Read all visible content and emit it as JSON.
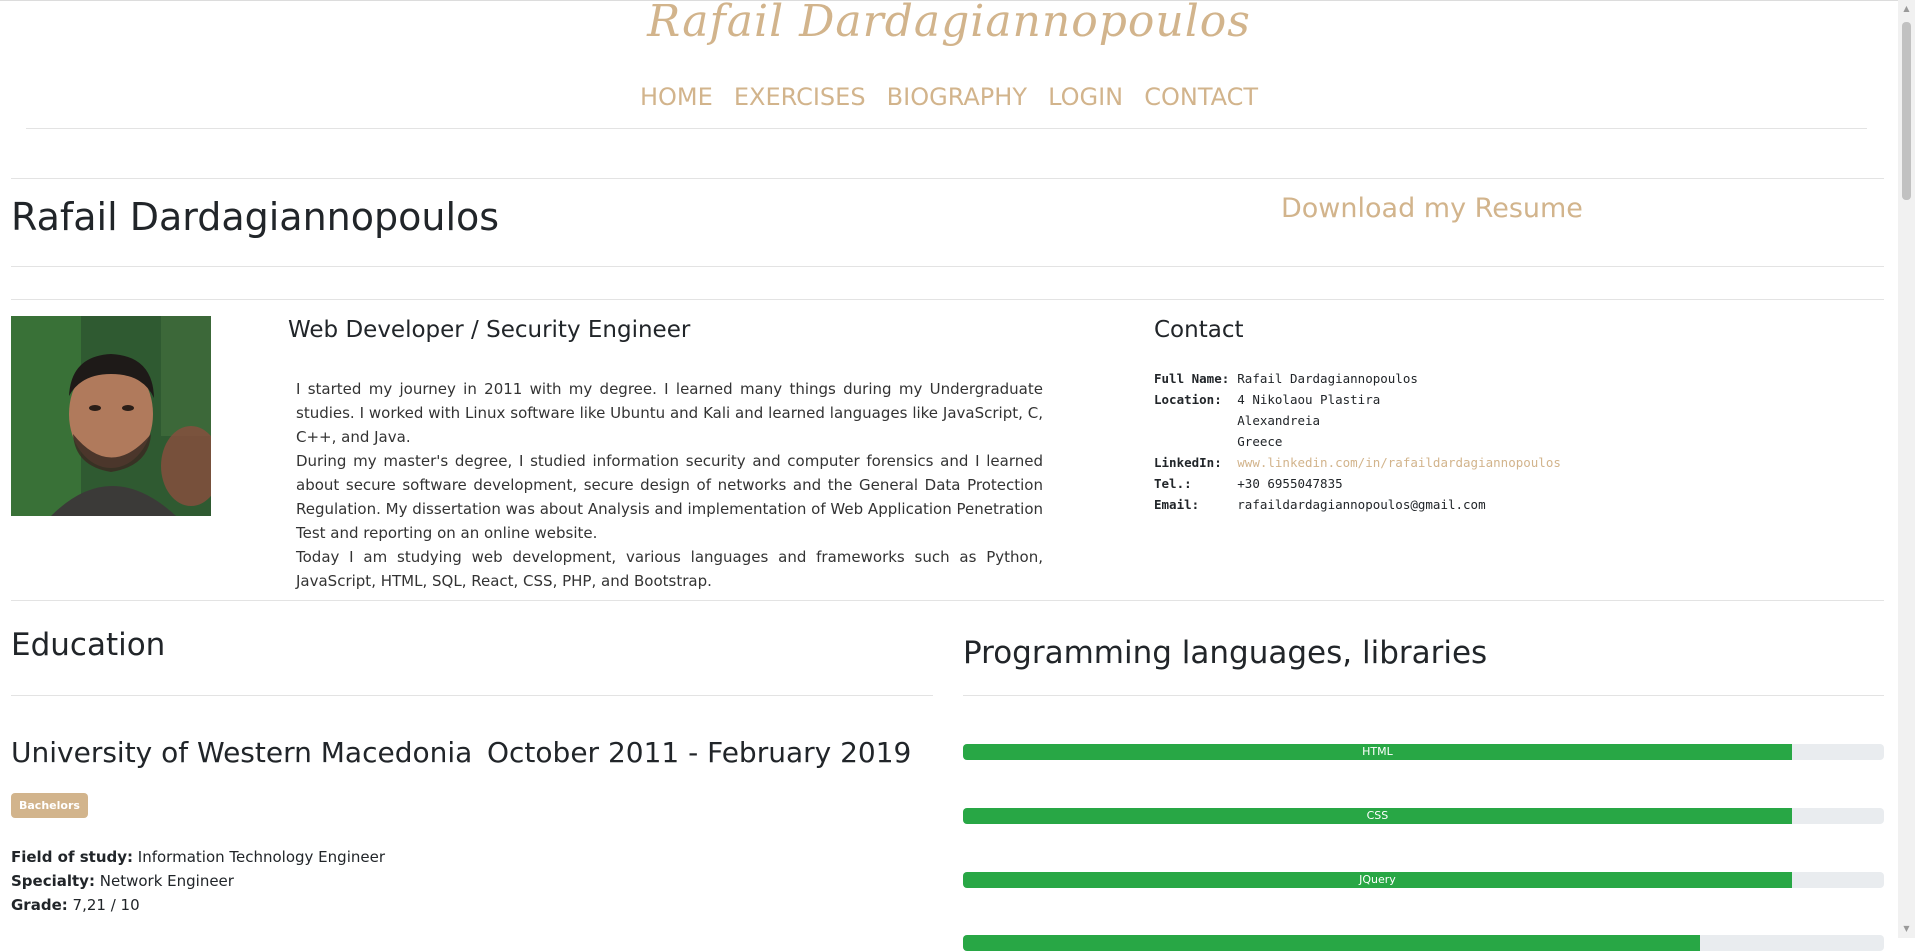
{
  "site": {
    "title": "Rafail Dardagiannopoulos"
  },
  "nav": [
    "HOME",
    "EXERCISES",
    "BIOGRAPHY",
    "LOGIN",
    "CONTACT"
  ],
  "header": {
    "name": "Rafail Dardagiannopoulos",
    "resume_link": "Download my Resume"
  },
  "profile": {
    "job_title": "Web Developer / Security Engineer",
    "bio": [
      "I started my journey in 2011 with my degree. I learned many things during my Undergraduate studies. I worked with Linux software like Ubuntu and Kali and learned languages like JavaScript, C, C++, and Java.",
      "During my master's degree, I studied information security and computer forensics and I learned about secure software development, secure design of networks and the General Data Protection Regulation. My dissertation was about Analysis and implementation of Web Application Penetration Test and reporting on an online website.",
      "Today I am studying web development, various languages and frameworks such as Python, JavaScript, HTML, SQL, React, CSS, PHP, and Bootstrap."
    ]
  },
  "contact": {
    "heading": "Contact",
    "full_name_label": "Full Name:",
    "full_name": "Rafail Dardagiannopoulos",
    "location_label": "Location:",
    "location": [
      "4 Nikolaou Plastira",
      "Alexandreia",
      "Greece"
    ],
    "linkedin_label": "LinkedIn:",
    "linkedin": "www.linkedin.com/in/rafaildardagiannopoulos",
    "tel_label": "Tel.:",
    "tel": "+30 6955047835",
    "email_label": "Email:",
    "email": "rafaildardagiannopoulos@gmail.com"
  },
  "education": {
    "heading": "Education",
    "entries": [
      {
        "school": "University of Western Macedonia",
        "period": "October 2011 - February 2019",
        "badge": "Bachelors",
        "field_label": "Field of study:",
        "field": "Information Technology Engineer",
        "specialty_label": "Specialty:",
        "specialty": "Network Engineer",
        "grade_label": "Grade:",
        "grade": "7,21 / 10"
      }
    ]
  },
  "skills": {
    "heading": "Programming languages, libraries",
    "items": [
      {
        "name": "HTML",
        "level": 0.9
      },
      {
        "name": "CSS",
        "level": 0.9
      },
      {
        "name": "JQuery",
        "level": 0.9
      },
      {
        "name": "",
        "level": 0.8
      }
    ]
  },
  "colors": {
    "accent": "#d2b48c",
    "bar": "#28a745",
    "track": "#e9ecef"
  }
}
